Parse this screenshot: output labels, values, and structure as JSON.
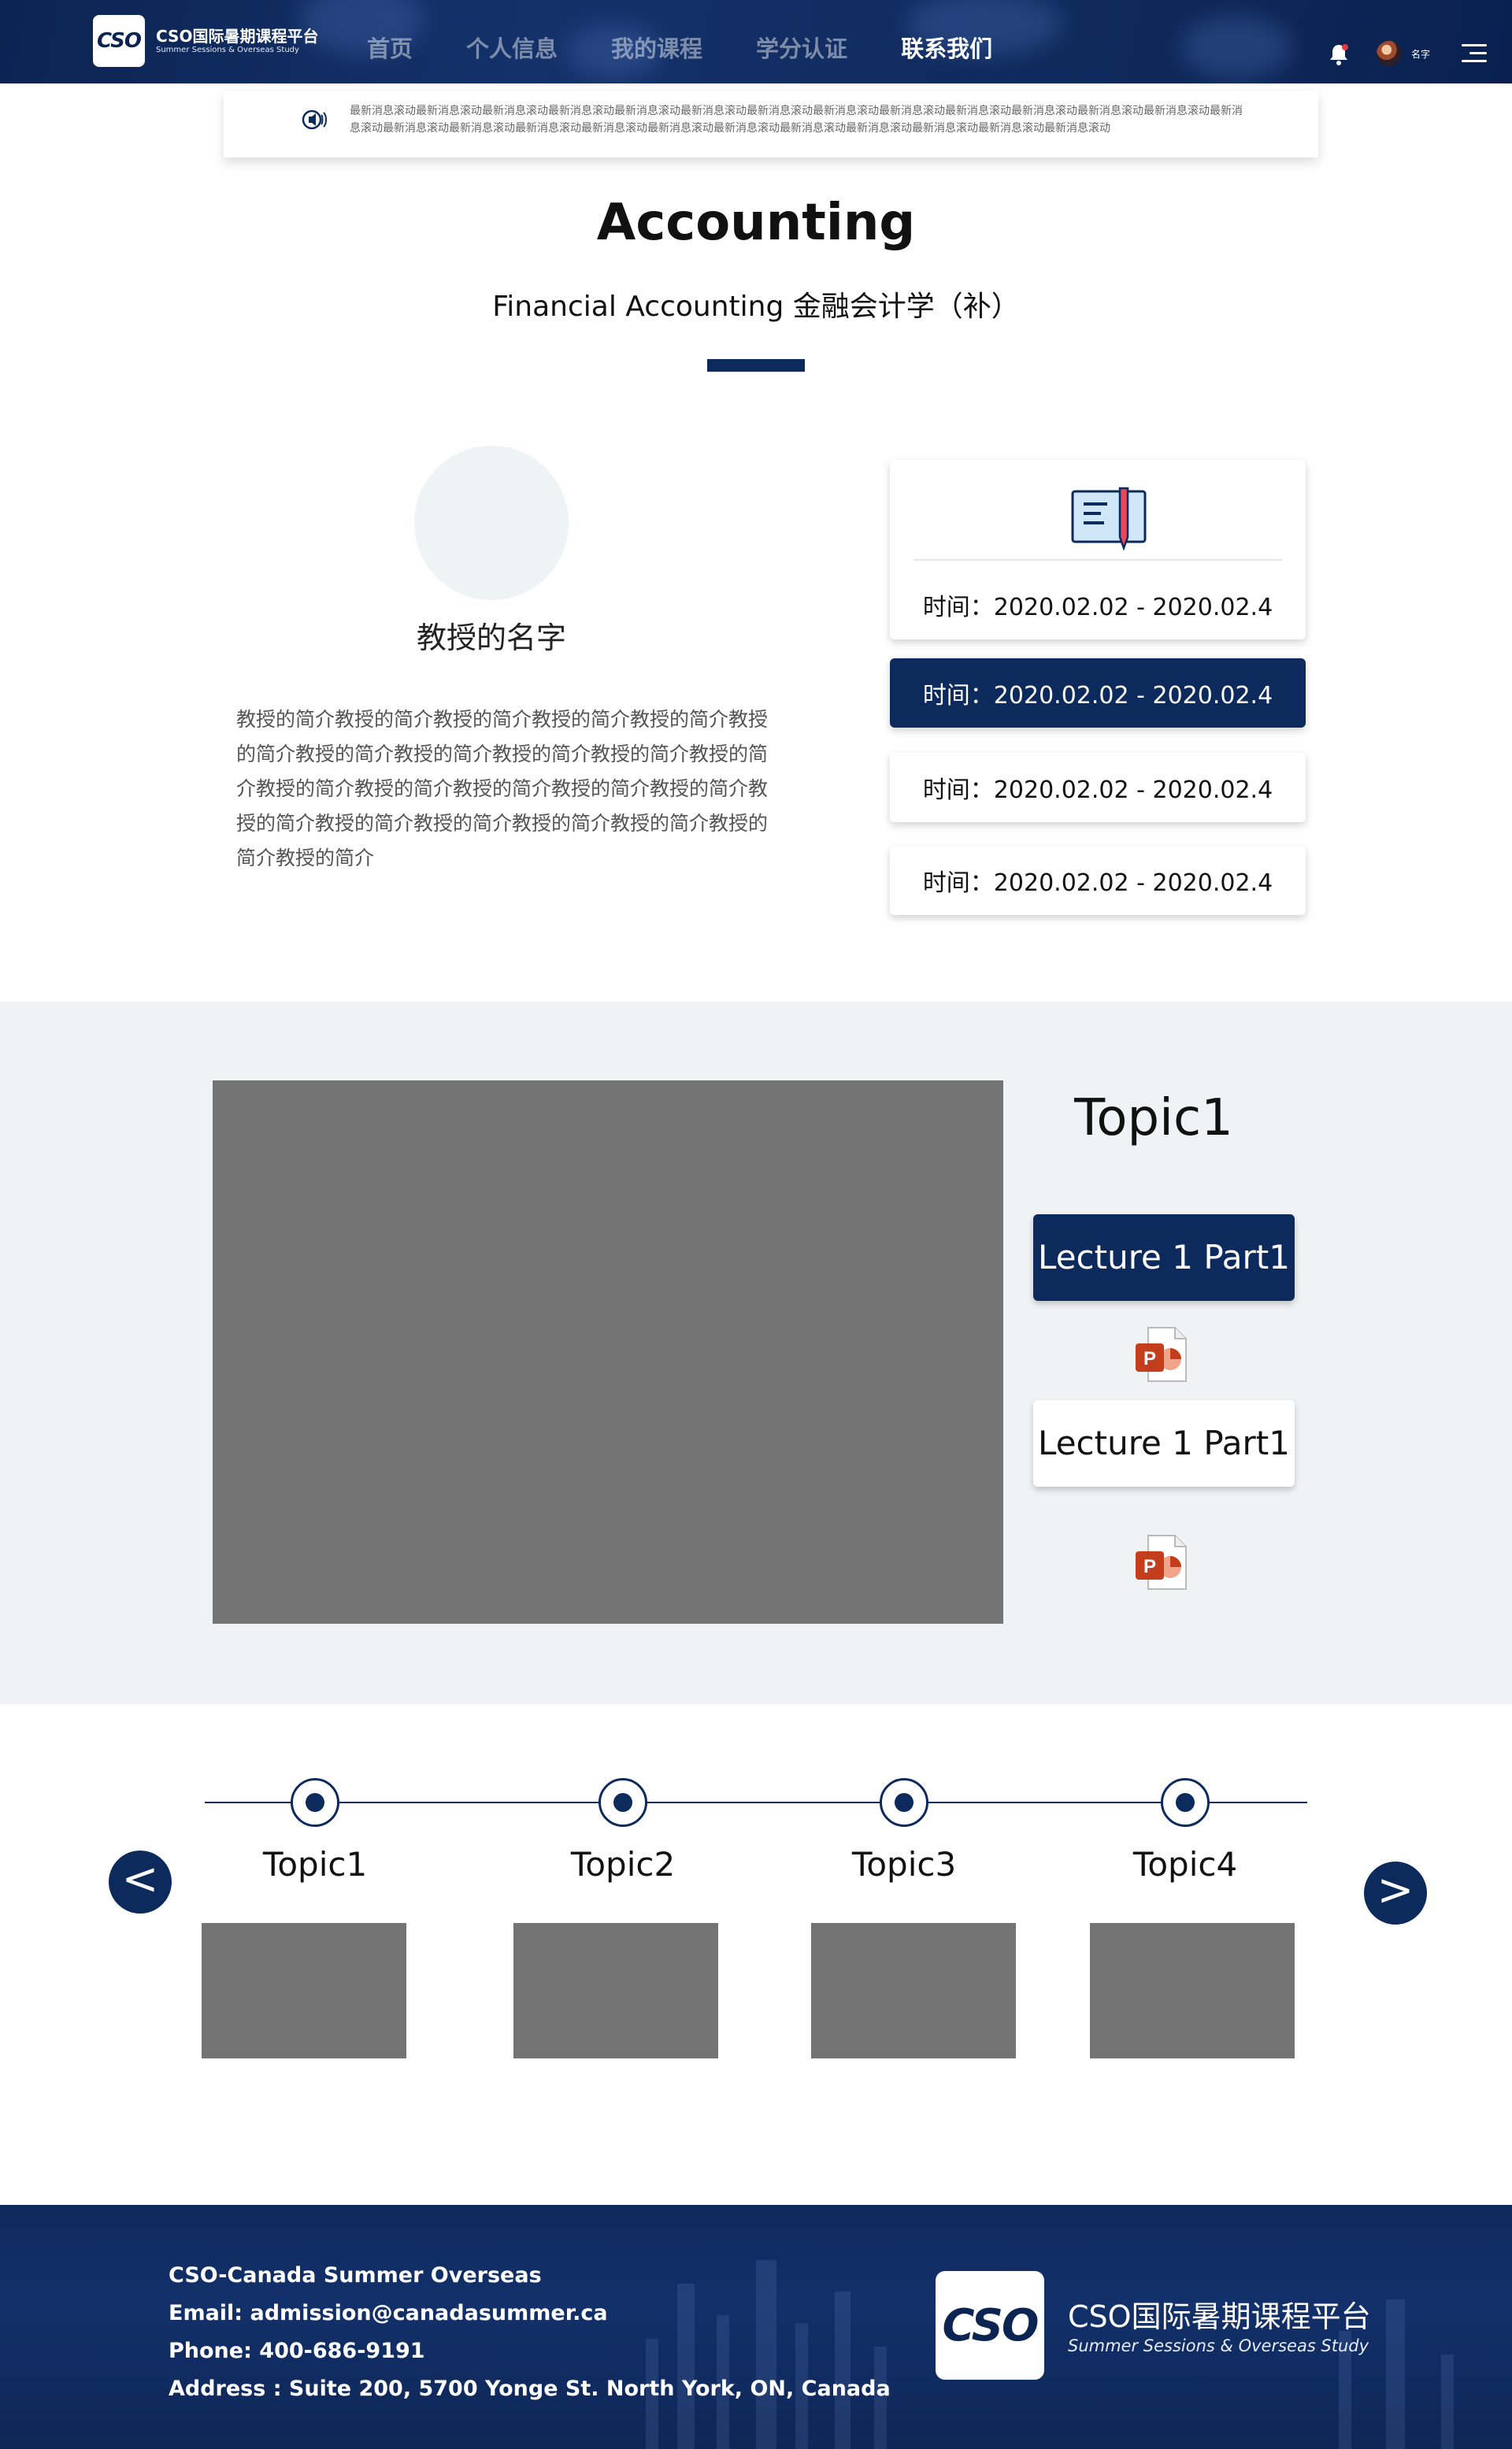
{
  "header": {
    "logo_text": "CSO",
    "brand_cn": "CSO国际暑期课程平台",
    "brand_en": "Summer Sessions & Overseas Study",
    "nav": [
      "首页",
      "个人信息",
      "我的课程",
      "学分认证",
      "联系我们"
    ],
    "active_nav": "联系我们",
    "user_name": "名字",
    "icons": [
      "bell-icon",
      "avatar",
      "menu-icon"
    ]
  },
  "ticker": {
    "text": "最新消息滚动最新消息滚动最新消息滚动最新消息滚动最新消息滚动最新消息滚动最新消息滚动最新消息滚动最新消息滚动最新消息滚动最新消息滚动最新消息滚动最新消息滚动最新消息滚动最新消息滚动最新消息滚动最新消息滚动最新消息滚动最新消息滚动最新消息滚动最新消息滚动最新消息滚动最新消息滚动最新消息滚动最新消息滚动"
  },
  "course": {
    "title": "Accounting",
    "subtitle": "Financial Accounting 金融会计学（补）"
  },
  "professor": {
    "name": "教授的名字",
    "intro": "教授的简介教授的简介教授的简介教授的简介教授的简介教授的简介教授的简介教授的简介教授的简介教授的简介教授的简介教授的简介教授的简介教授的简介教授的简介教授的简介教授的简介教授的简介教授的简介教授的简介教授的简介教授的简介教授的简介"
  },
  "dates": [
    "时间：2020.02.02 - 2020.02.4",
    "时间：2020.02.02 - 2020.02.4",
    "时间：2020.02.02 - 2020.02.4",
    "时间：2020.02.02 - 2020.02.4"
  ],
  "lecture": {
    "topic": "Topic1",
    "buttons": [
      "Lecture 1 Part1",
      "Lecture 1 Part1"
    ]
  },
  "timeline": {
    "topics": [
      "Topic1",
      "Topic2",
      "Topic3",
      "Topic4"
    ],
    "prev": "<",
    "next": ">"
  },
  "footer": {
    "org": "CSO-Canada Summer Overseas",
    "email": "Email: admission@canadasummer.ca",
    "phone": "Phone: 400-686-9191",
    "address": "Address : Suite 200, 5700 Yonge St. North York, ON, Canada",
    "logo_text": "CSO",
    "brand_cn": "CSO国际暑期课程平台",
    "brand_en": "Summer Sessions & Overseas Study"
  },
  "colors": {
    "primary": "#0d2a5c",
    "section_bg": "#f0f2f5",
    "placeholder": "#747474"
  }
}
